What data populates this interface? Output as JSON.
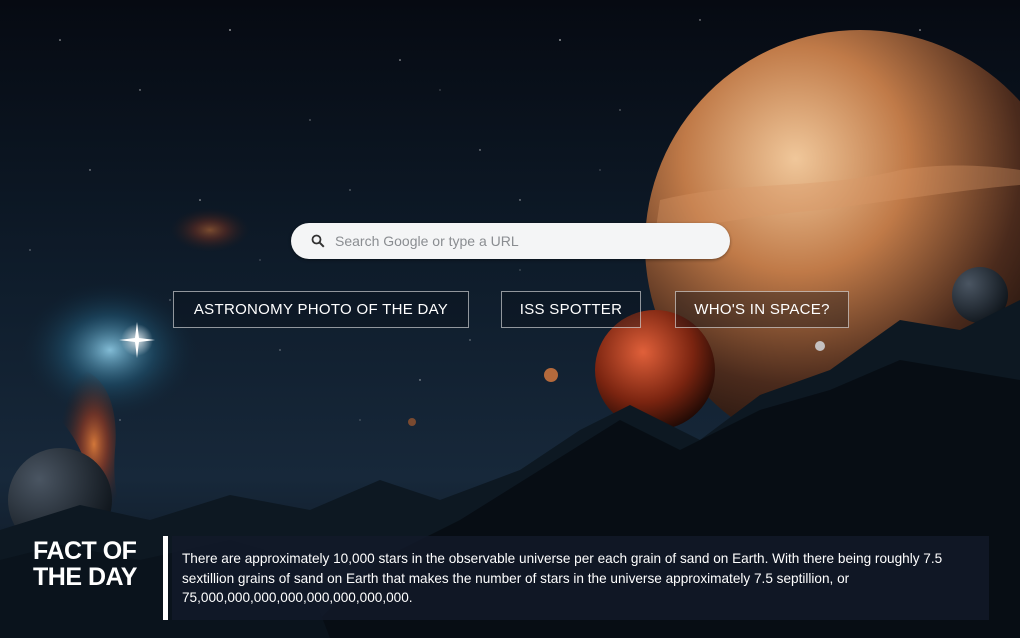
{
  "search": {
    "placeholder": "Search Google or type a URL"
  },
  "buttons": {
    "apod": "ASTRONOMY PHOTO OF THE DAY",
    "iss": "ISS SPOTTER",
    "whos_in_space": "WHO'S IN SPACE?"
  },
  "fact": {
    "heading_line1": "FACT OF",
    "heading_line2": "THE DAY",
    "text": "There are approximately 10,000 stars in the observable universe per each grain of sand on Earth. With there being roughly 7.5 sextillion grains of sand on Earth that makes the number of stars in the universe approximately 7.5 septillion, or 75,000,000,000,000,000,000,000,000."
  },
  "colors": {
    "button_border": "#ffffff",
    "fact_box": "#121a2a",
    "search_bg": "#f4f5f6"
  }
}
